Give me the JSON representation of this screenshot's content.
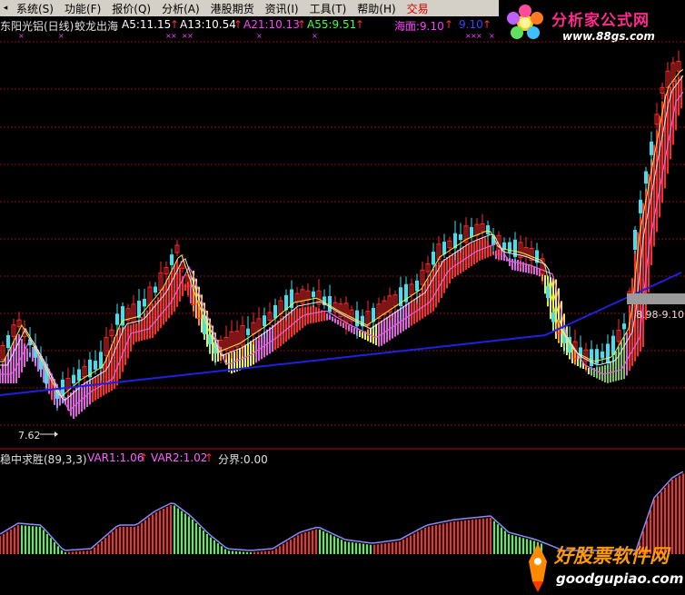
{
  "menu": {
    "items": [
      "系统(S)",
      "功能(F)",
      "报价(Q)",
      "分析(A)",
      "港股期货",
      "资讯(I)",
      "工具(T)",
      "帮助(H)",
      "交易"
    ],
    "arrow": "◂"
  },
  "watermark_top": {
    "title": "分析家公式网",
    "url": "www.88gs.com"
  },
  "watermark_bottom": {
    "title": "好股票软件网",
    "url": "goodgupiao.com"
  },
  "main_header": {
    "title": "东阳光铝(日线)",
    "indicator": "蛟龙出海",
    "a5": "A5:11.15",
    "a13": "A13:10.54",
    "a21": "A21:10.13",
    "a55": "A55:9.51",
    "haimian": "海面:9.10",
    "v910": "9.10",
    "arrow": "↑"
  },
  "main_chart": {
    "low_label": "7.62",
    "right_label": "8.98-9.10"
  },
  "sub_header": {
    "name": "稳中求胜(89,3,3)",
    "var1": "VAR1:1.06",
    "var2": "VAR2:1.02",
    "fenjie": "分界:0.00",
    "arrow": "↑"
  },
  "colors": {
    "background": "#000000",
    "up": "#ff2a2a",
    "down": "#40e0f0",
    "ma_blue": "#2020e0",
    "band_pink": "#e060e0",
    "band_yellow": "#f0f040",
    "grid": "#8a1010",
    "osc_green": "#40ff40"
  },
  "chart_data": {
    "type": "line",
    "title": "东阳光铝(日线)",
    "xlabel": "",
    "ylabel": "",
    "series": [
      {
        "name": "A5",
        "values": [
          11.15
        ]
      },
      {
        "name": "A13",
        "values": [
          10.54
        ]
      },
      {
        "name": "A21",
        "values": [
          10.13
        ]
      },
      {
        "name": "A55",
        "values": [
          9.51
        ]
      },
      {
        "name": "海面",
        "values": [
          9.1
        ]
      }
    ],
    "annotations": [
      "7.62",
      "8.98-9.10"
    ],
    "grid": true
  }
}
